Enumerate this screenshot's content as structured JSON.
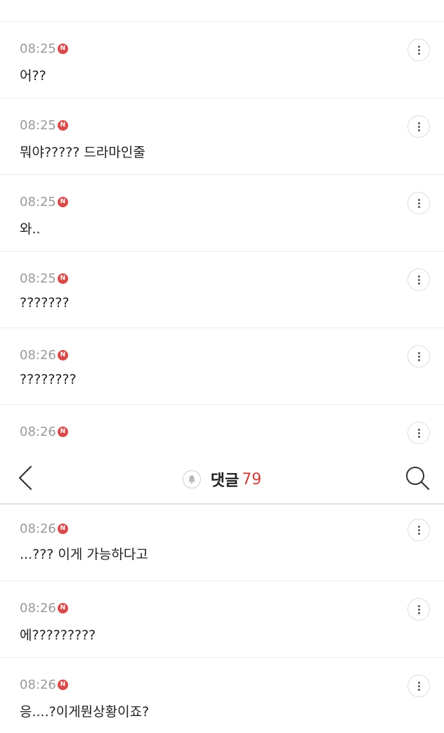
{
  "header": {
    "title": "댓글",
    "count": "79"
  },
  "badge_label": "N",
  "comments_top": [
    {
      "time": "08:25",
      "text": "어??"
    },
    {
      "time": "08:25",
      "text": "뭐야????? 드라마인줄"
    },
    {
      "time": "08:25",
      "text": "와.."
    },
    {
      "time": "08:25",
      "text": "???????"
    },
    {
      "time": "08:26",
      "text": "????????"
    },
    {
      "time": "08:26",
      "text": ""
    }
  ],
  "comments_bottom": [
    {
      "time": "08:26",
      "text": "...??? 이게 가능하다고"
    },
    {
      "time": "08:26",
      "text": "에?????????"
    },
    {
      "time": "08:26",
      "text": "응....?이게뭔상황이죠?"
    }
  ]
}
